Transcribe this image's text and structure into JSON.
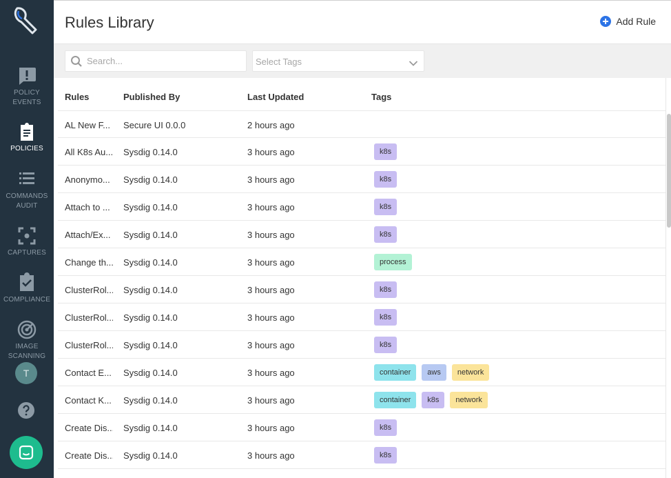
{
  "header": {
    "title": "Rules Library",
    "add_rule": "Add Rule"
  },
  "filters": {
    "search_placeholder": "Search...",
    "tags_placeholder": "Select Tags"
  },
  "nav": {
    "policy_events": [
      "Policy",
      "Events"
    ],
    "policies": [
      "Policies"
    ],
    "commands_audit": [
      "Commands",
      "Audit"
    ],
    "captures": [
      "Captures"
    ],
    "compliance": [
      "Compliance"
    ],
    "image_scanning": [
      "Image",
      "Scanning"
    ],
    "avatar": "T"
  },
  "table": {
    "columns": [
      "Rules",
      "Published By",
      "Last Updated",
      "Tags"
    ],
    "rows": [
      {
        "rule": "AL New F...",
        "published_by": "Secure UI 0.0.0",
        "updated": "2 hours ago",
        "tags": []
      },
      {
        "rule": "All K8s Au...",
        "published_by": "Sysdig 0.14.0",
        "updated": "3 hours ago",
        "tags": [
          "k8s"
        ]
      },
      {
        "rule": "Anonymo...",
        "published_by": "Sysdig 0.14.0",
        "updated": "3 hours ago",
        "tags": [
          "k8s"
        ]
      },
      {
        "rule": "Attach to ...",
        "published_by": "Sysdig 0.14.0",
        "updated": "3 hours ago",
        "tags": [
          "k8s"
        ]
      },
      {
        "rule": "Attach/Ex...",
        "published_by": "Sysdig 0.14.0",
        "updated": "3 hours ago",
        "tags": [
          "k8s"
        ]
      },
      {
        "rule": "Change th...",
        "published_by": "Sysdig 0.14.0",
        "updated": "3 hours ago",
        "tags": [
          "process"
        ]
      },
      {
        "rule": "ClusterRol...",
        "published_by": "Sysdig 0.14.0",
        "updated": "3 hours ago",
        "tags": [
          "k8s"
        ]
      },
      {
        "rule": "ClusterRol...",
        "published_by": "Sysdig 0.14.0",
        "updated": "3 hours ago",
        "tags": [
          "k8s"
        ]
      },
      {
        "rule": "ClusterRol...",
        "published_by": "Sysdig 0.14.0",
        "updated": "3 hours ago",
        "tags": [
          "k8s"
        ]
      },
      {
        "rule": "Contact E...",
        "published_by": "Sysdig 0.14.0",
        "updated": "3 hours ago",
        "tags": [
          "container",
          "aws",
          "network"
        ]
      },
      {
        "rule": "Contact K...",
        "published_by": "Sysdig 0.14.0",
        "updated": "3 hours ago",
        "tags": [
          "container",
          "k8s",
          "network"
        ]
      },
      {
        "rule": "Create Dis...",
        "published_by": "Sysdig 0.14.0",
        "updated": "3 hours ago",
        "tags": [
          "k8s"
        ]
      },
      {
        "rule": "Create Dis...",
        "published_by": "Sysdig 0.14.0",
        "updated": "3 hours ago",
        "tags": [
          "k8s"
        ]
      }
    ]
  },
  "tag_colors": {
    "k8s": "#c8bdf2",
    "process": "#b3f2d5",
    "container": "#8ee3ec",
    "aws": "#b7c9f2",
    "network": "#fbe49a"
  },
  "colors": {
    "sidebar": "#233340",
    "accent": "#2d74e6",
    "chat": "#1ebc8e"
  }
}
